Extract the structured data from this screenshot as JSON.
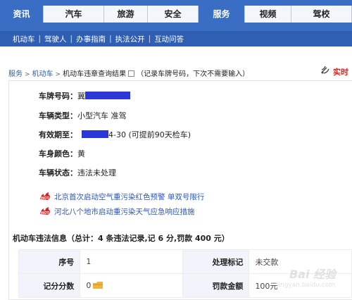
{
  "topnav": {
    "tabs": [
      {
        "label": "资讯",
        "active": true,
        "width": 62
      },
      {
        "label": "汽车",
        "active": false,
        "width": 86
      },
      {
        "label": "旅游",
        "active": false,
        "width": 62
      },
      {
        "label": "安全",
        "active": false,
        "width": 72
      },
      {
        "label": "服务",
        "active": true,
        "width": 66
      },
      {
        "label": "视频",
        "active": false,
        "width": 66
      },
      {
        "label": "驾校",
        "active": false,
        "width": 86
      }
    ]
  },
  "subnav": {
    "items": [
      "机动车",
      "驾驶人",
      "办事指南",
      "执法公开",
      "互动问答"
    ],
    "separator": "|"
  },
  "breadcrumb": {
    "home": "服务",
    "section": "机动车",
    "current": "机动车违章查询结果",
    "checkbox_note": "（记录车牌号码，下次不需要输入）",
    "right_text": "实时"
  },
  "vehicle": {
    "plate_label": "车牌号码：",
    "plate_value": "冀",
    "type_label": "车辆类型：",
    "type_value": "小型汽车 准驾",
    "expiry_label": "有效期至：",
    "expiry_value": "4-30 (可提前90天检车)",
    "color_label": "车身颜色：",
    "color_value": "黄",
    "status_label": "车辆状态：",
    "status_value": "违法未处理"
  },
  "notices": [
    {
      "icon": "hot-icon",
      "text": "北京首次启动空气重污染红色预警 单双号限行"
    },
    {
      "icon": "hot-icon",
      "text": "河北八个地市启动重污染天气应急响应措施"
    }
  ],
  "violations": {
    "summary": "机动车违法信息（总计：4 条违法记录,记 6 分,罚款 400 元）",
    "row1": {
      "h1": "序号",
      "v1": "1",
      "h2": "处理标记",
      "v2": "未交款"
    },
    "row2": {
      "h1": "记分分数",
      "v1": "0",
      "h2": "罚款金额",
      "v2": "100元"
    }
  },
  "watermark": {
    "line1": "Bai 经验",
    "line2": "jingyan.baidu.com"
  },
  "colors": {
    "nav_blue": "#3a6ec4",
    "link_blue": "#2a55b8",
    "mask_blue": "#2b37d8",
    "alert_red": "#d22"
  }
}
